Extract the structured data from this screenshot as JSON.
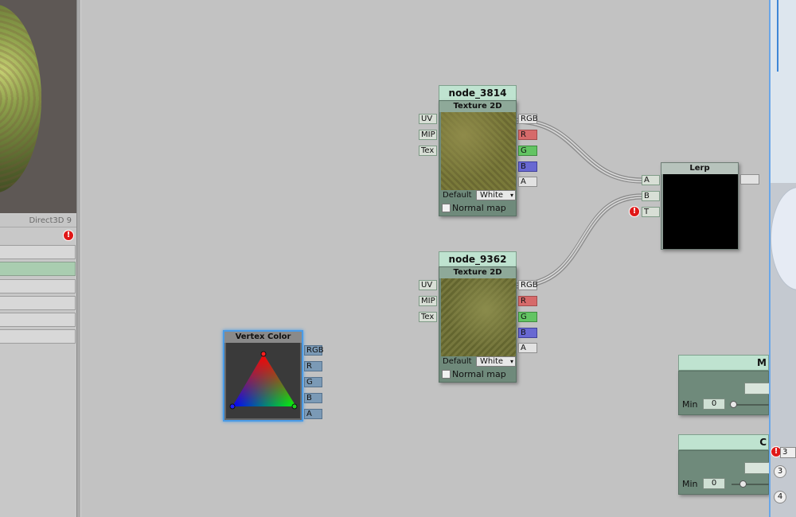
{
  "left_panel": {
    "renderer": "Direct3D 9"
  },
  "nodes": {
    "tex1": {
      "name": "node_3814",
      "type": "Texture 2D",
      "inputs": [
        "UV",
        "MIP",
        "Tex"
      ],
      "outputs": [
        "RGB",
        "R",
        "G",
        "B",
        "A"
      ],
      "default_label": "Default",
      "default_value": "White",
      "normal_map_label": "Normal map"
    },
    "tex2": {
      "name": "node_9362",
      "type": "Texture 2D",
      "inputs": [
        "UV",
        "MIP",
        "Tex"
      ],
      "outputs": [
        "RGB",
        "R",
        "G",
        "B",
        "A"
      ],
      "default_label": "Default",
      "default_value": "White",
      "normal_map_label": "Normal map"
    },
    "lerp": {
      "type": "Lerp",
      "inputs": [
        "A",
        "B",
        "T"
      ]
    },
    "vertex_color": {
      "type": "Vertex Color",
      "outputs": [
        "RGB",
        "R",
        "G",
        "B",
        "A"
      ]
    }
  },
  "property_nodes": [
    {
      "title": "M",
      "min_label": "Min",
      "min_value": "0",
      "slider_value": 0.0
    },
    {
      "title": "C",
      "min_label": "Min",
      "min_value": "0",
      "slider_value": 0.25
    }
  ],
  "right_edge": {
    "badge_a": "3",
    "badge_b": "4",
    "count": "3"
  },
  "icons": {
    "warning": "warning-icon",
    "dropdown": "dropdown-arrow-icon"
  },
  "colors": {
    "canvas": "#c2c2c2",
    "node_title": "#bfe3d0",
    "node_body": "#6f8a7b",
    "port_r": "#d66a6a",
    "port_g": "#63c463",
    "port_b": "#6868d2",
    "selection": "#4a9be6"
  }
}
